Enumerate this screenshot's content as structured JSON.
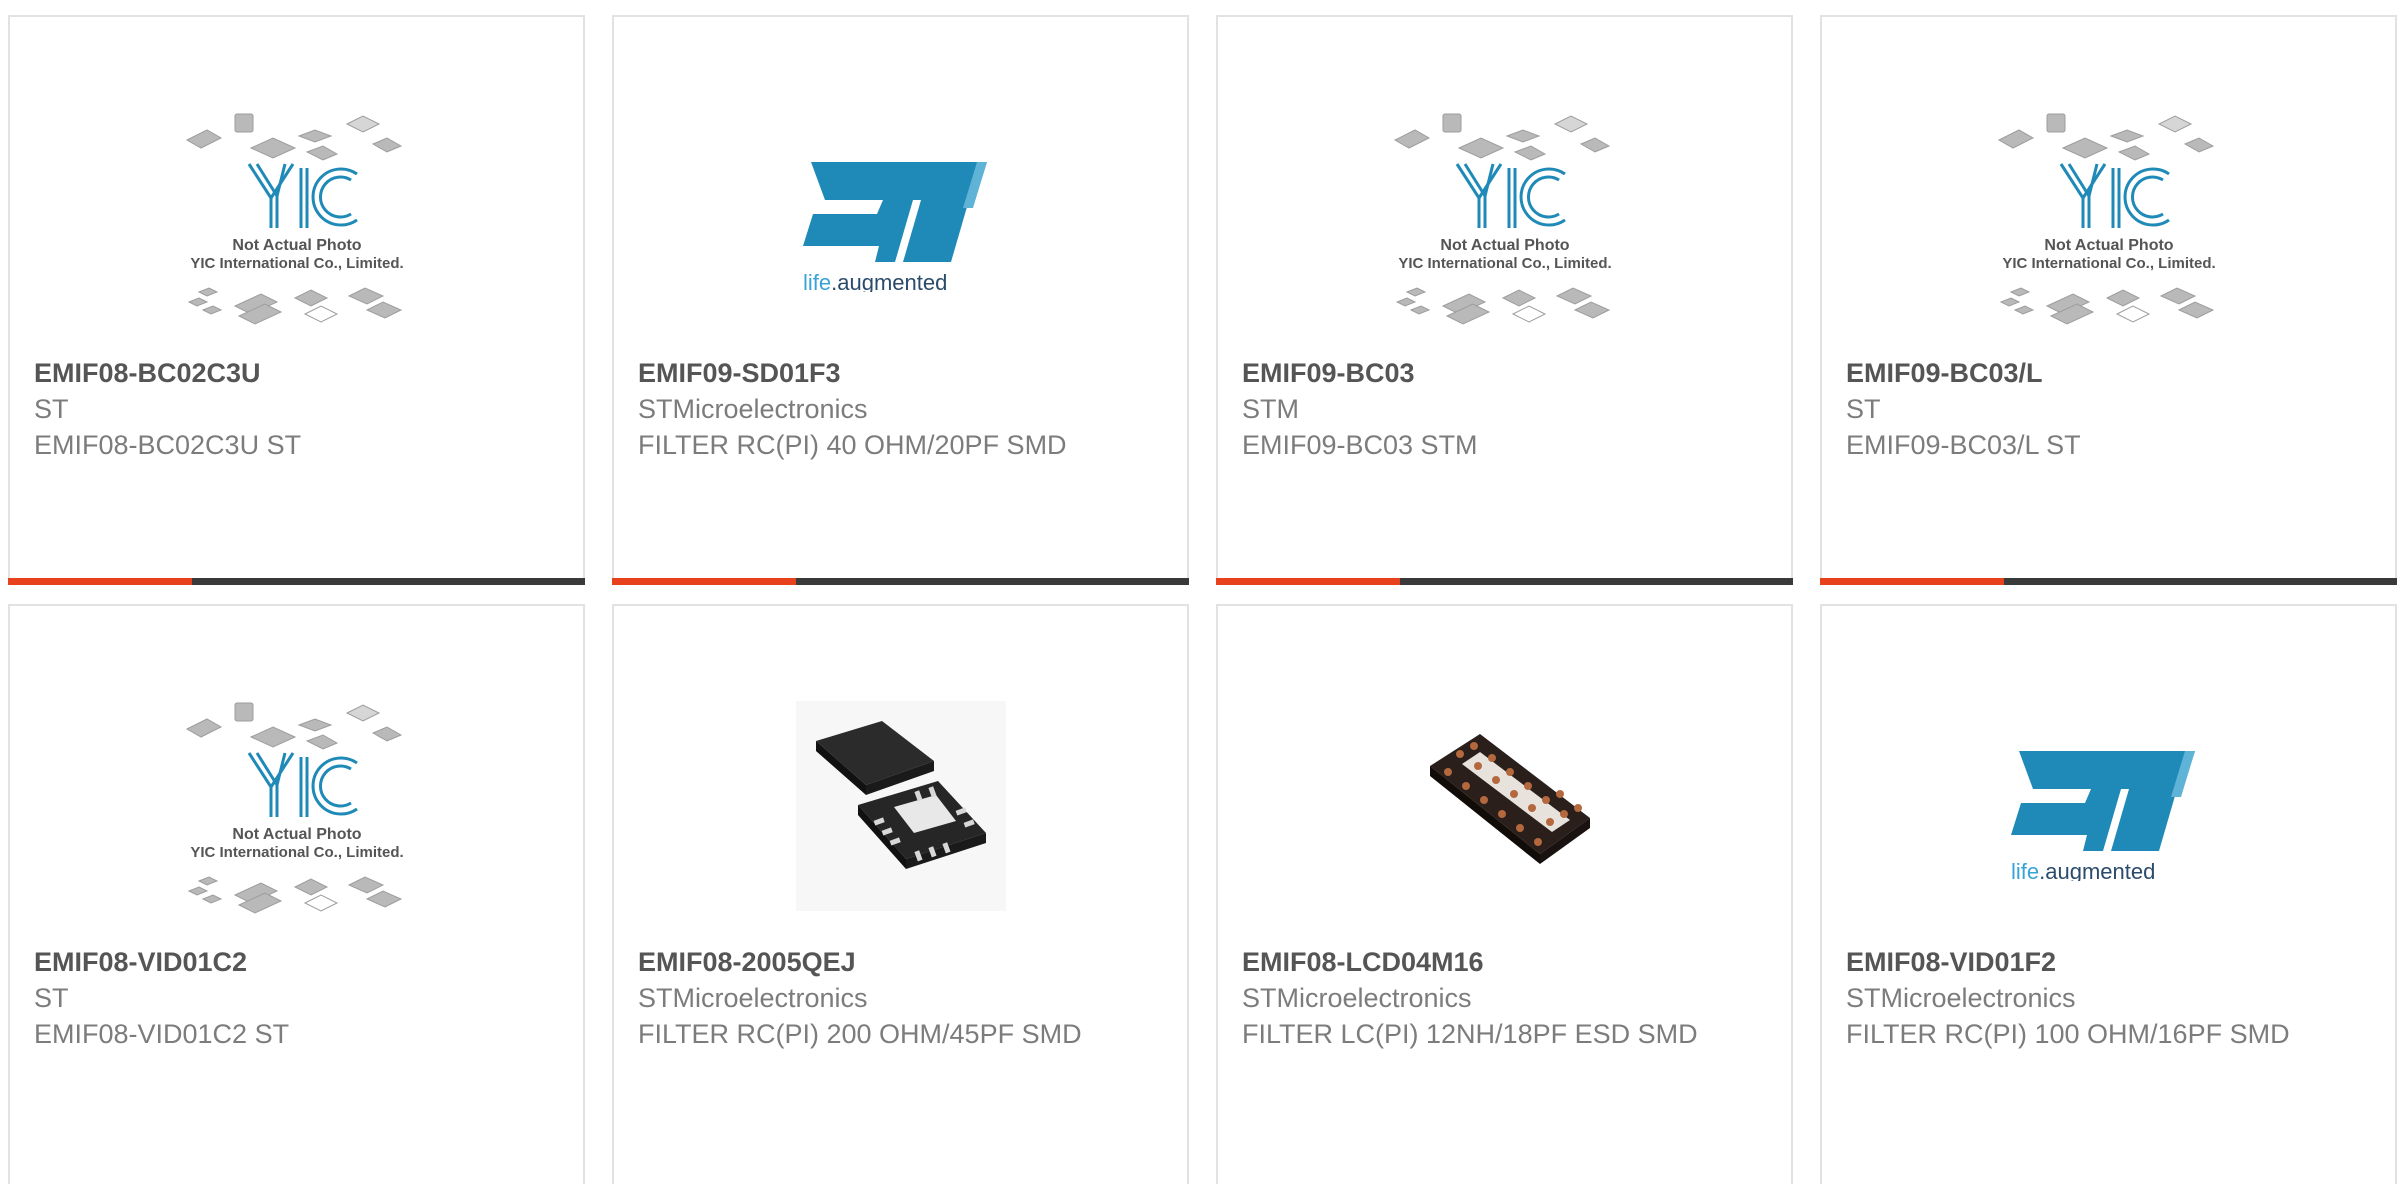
{
  "theme": {
    "accent": "#e8411e",
    "bar": "#3a3a3a",
    "border": "#e2e2e2",
    "st_blue": "#1f8ab8"
  },
  "placeholder": {
    "line1": "Not Actual Photo",
    "line2": "YIC International Co., Limited.",
    "logo_text": "YIC"
  },
  "st_logo": {
    "tagline_life": "life",
    "tagline_aug": ".augmented"
  },
  "products": [
    {
      "part": "EMIF08-BC02C3U",
      "manufacturer": "ST",
      "description": "EMIF08-BC02C3U ST",
      "image": "yic-placeholder"
    },
    {
      "part": "EMIF09-SD01F3",
      "manufacturer": "STMicroelectronics",
      "description": "FILTER RC(PI) 40 OHM/20PF SMD",
      "image": "st-logo"
    },
    {
      "part": "EMIF09-BC03",
      "manufacturer": "STM",
      "description": "EMIF09-BC03 STM",
      "image": "yic-placeholder"
    },
    {
      "part": "EMIF09-BC03/L",
      "manufacturer": "ST",
      "description": "EMIF09-BC03/L ST",
      "image": "yic-placeholder"
    },
    {
      "part": "EMIF08-VID01C2",
      "manufacturer": "ST",
      "description": "EMIF08-VID01C2 ST",
      "image": "yic-placeholder"
    },
    {
      "part": "EMIF08-2005QEJ",
      "manufacturer": "STMicroelectronics",
      "description": "FILTER RC(PI) 200 OHM/45PF SMD",
      "image": "qfn-chip-photo"
    },
    {
      "part": "EMIF08-LCD04M16",
      "manufacturer": "STMicroelectronics",
      "description": "FILTER LC(PI) 12NH/18PF ESD SMD",
      "image": "dfn-chip-photo"
    },
    {
      "part": "EMIF08-VID01F2",
      "manufacturer": "STMicroelectronics",
      "description": "FILTER RC(PI) 100 OHM/16PF SMD",
      "image": "st-logo"
    }
  ]
}
